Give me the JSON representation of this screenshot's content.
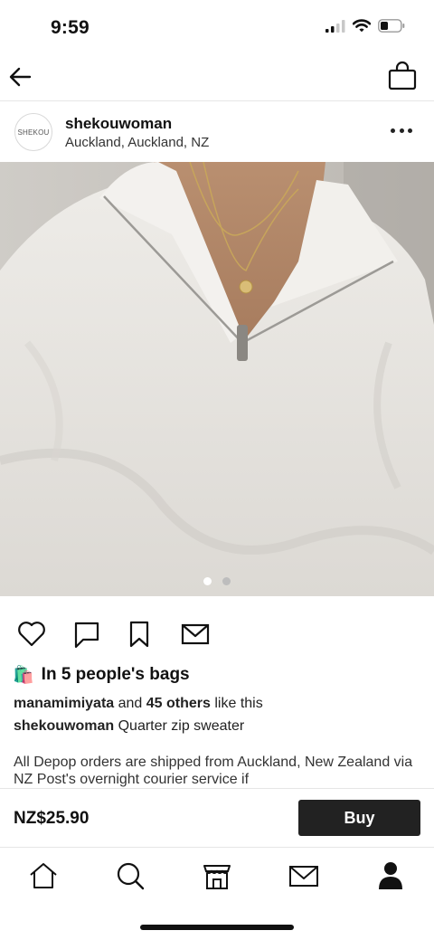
{
  "status_bar": {
    "time": "9:59",
    "icons": [
      "signal-icon",
      "wifi-icon",
      "battery-icon"
    ]
  },
  "nav": {
    "back_icon": "arrow-left-icon",
    "bag_icon": "shopping-bag-icon"
  },
  "seller": {
    "avatar_text": "SHEKOU",
    "username": "shekouwoman",
    "location": "Auckland, Auckland, NZ",
    "more_icon": "more-horizontal-icon"
  },
  "photo": {
    "total_images": 2,
    "current_index": 1
  },
  "actions": [
    {
      "name": "like",
      "icon": "heart-icon"
    },
    {
      "name": "comment",
      "icon": "comment-icon"
    },
    {
      "name": "save",
      "icon": "bookmark-icon"
    },
    {
      "name": "message",
      "icon": "mail-icon"
    }
  ],
  "bags": {
    "emoji": "🛍️",
    "text": "In 5 people's bags"
  },
  "likes": {
    "first_user": "manamimiyata",
    "and": "and",
    "others": "45 others",
    "suffix": "like this"
  },
  "listing": {
    "seller": "shekouwoman",
    "title": "Quarter zip sweater",
    "description": "All Depop orders are shipped from Auckland, New Zealand via NZ Post's overnight courier service if"
  },
  "purchase": {
    "price": "NZ$25.90",
    "buy_label": "Buy"
  },
  "tab_bar": [
    {
      "name": "home",
      "icon": "home-icon"
    },
    {
      "name": "search",
      "icon": "search-icon"
    },
    {
      "name": "shop",
      "icon": "store-icon"
    },
    {
      "name": "inbox",
      "icon": "mail-icon"
    },
    {
      "name": "profile",
      "icon": "person-icon"
    }
  ],
  "colors": {
    "primary": "#222222",
    "background": "#ffffff",
    "divider": "#e6e6e6"
  }
}
